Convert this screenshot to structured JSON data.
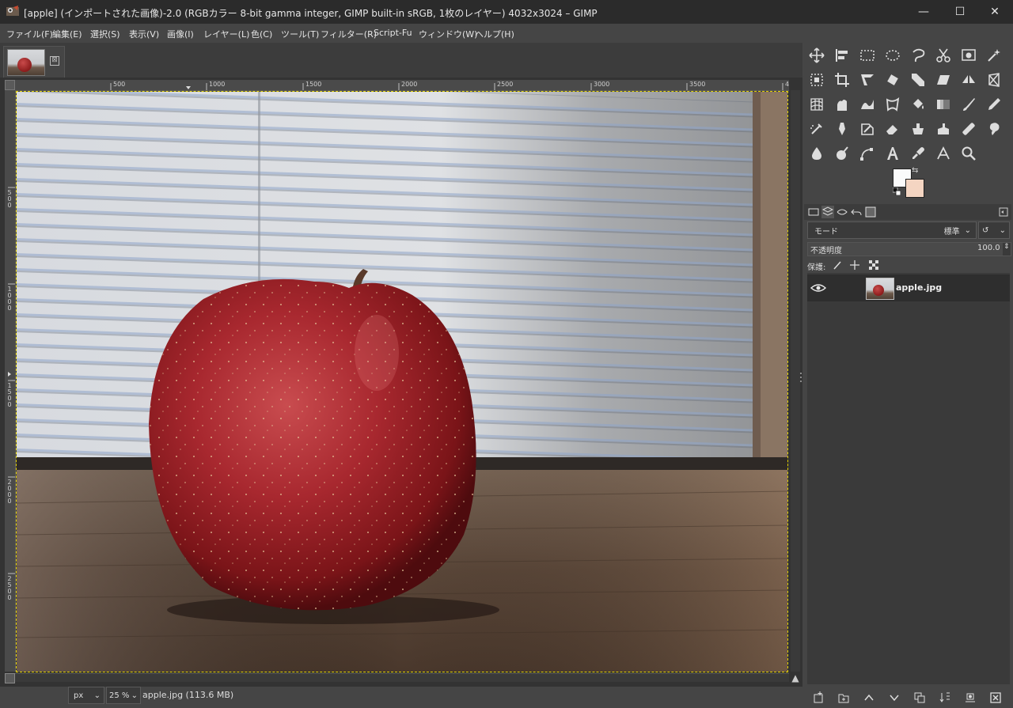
{
  "window": {
    "title": "[apple] (インポートされた画像)-2.0 (RGBカラー 8-bit gamma integer, GIMP built-in sRGB, 1枚のレイヤー) 4032x3024 – GIMP",
    "minimize_glyph": "—",
    "maximize_glyph": "☐",
    "close_glyph": "✕"
  },
  "menu": [
    {
      "label": "ファイル(F)"
    },
    {
      "label": "編集(E)"
    },
    {
      "label": "選択(S)"
    },
    {
      "label": "表示(V)"
    },
    {
      "label": "画像(I)"
    },
    {
      "label": "レイヤー(L)"
    },
    {
      "label": "色(C)"
    },
    {
      "label": "ツール(T)"
    },
    {
      "label": "フィルター(R)"
    },
    {
      "label": "Script-Fu"
    },
    {
      "label": "ウィンドウ(W)"
    },
    {
      "label": "ヘルプ(H)"
    }
  ],
  "image_tab": {
    "close_glyph": "⊠"
  },
  "rulers": {
    "horizontal": [
      "500",
      "1000",
      "1500",
      "2000",
      "2500",
      "3000",
      "3500",
      "4"
    ],
    "vertical": [
      "500",
      "1000",
      "1500",
      "2000",
      "2500"
    ]
  },
  "status": {
    "unit": "px",
    "zoom": "25 %",
    "file_info": "apple.jpg (113.6 MB)"
  },
  "colors": {
    "foreground": "#fafafa",
    "background": "#f4d5c2",
    "selection_marquee": "#e3d100"
  },
  "layers_panel": {
    "mode_label": "モード",
    "mode_value": "標準",
    "opacity_label": "不透明度",
    "opacity_value": "100.0",
    "lock_label": "保護:",
    "layers": [
      {
        "name": "apple.jpg",
        "visible": true
      }
    ]
  },
  "tools": [
    "move-icon",
    "align-icon",
    "rect-select-icon",
    "ellipse-select-icon",
    "free-select-icon",
    "scissors-select-icon",
    "foreground-select-icon",
    "fuzzy-select-icon",
    "color-select-icon",
    "crop-icon",
    "unified-transform-icon",
    "rotate-icon",
    "scale-icon",
    "shear-icon",
    "flip-icon",
    "perspective-icon",
    "warp-icon",
    "cage-icon",
    "handle-transform-icon",
    "n-point-deform-icon",
    "bucket-fill-icon",
    "gradient-icon",
    "paintbrush-icon",
    "pencil-icon",
    "airbrush-icon",
    "ink-icon",
    "mypaint-icon",
    "eraser-icon",
    "clone-icon",
    "perspective-clone-icon",
    "heal-icon",
    "smudge-icon",
    "blur-icon",
    "dodge-icon",
    "paths-icon",
    "text-icon",
    "color-picker-icon",
    "measure-icon",
    "zoom-icon"
  ]
}
